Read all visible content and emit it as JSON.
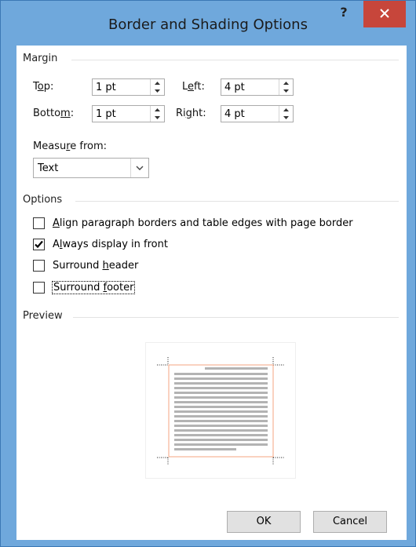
{
  "window": {
    "title": "Border and Shading Options",
    "help_label": "?"
  },
  "margin": {
    "section_label": "Margin",
    "top": {
      "label_pre": "T",
      "label_u": "o",
      "label_post": "p:",
      "value": "1 pt"
    },
    "bottom": {
      "label_pre": "Botto",
      "label_u": "m",
      "label_post": ":",
      "value": "1 pt"
    },
    "left": {
      "label_pre": "L",
      "label_u": "e",
      "label_post": "ft:",
      "value": "4 pt"
    },
    "right": {
      "label_pre": "Ri",
      "label_u": "g",
      "label_post": "ht:",
      "value": "4 pt"
    },
    "measure_from": {
      "label_pre": "Measu",
      "label_u": "r",
      "label_post": "e from:",
      "value": "Text"
    }
  },
  "options": {
    "section_label": "Options",
    "items": [
      {
        "pre": "",
        "u": "A",
        "post": "lign paragraph borders and table edges with page border",
        "checked": false
      },
      {
        "pre": "A",
        "u": "l",
        "post": "ways display in front",
        "checked": true
      },
      {
        "pre": "Surround ",
        "u": "h",
        "post": "eader",
        "checked": false
      },
      {
        "pre": "Surround ",
        "u": "f",
        "post": "ooter",
        "checked": false
      }
    ]
  },
  "preview": {
    "section_label": "Preview"
  },
  "buttons": {
    "ok": "OK",
    "cancel": "Cancel"
  },
  "colors": {
    "title_bg": "#6fa8dc",
    "close_bg": "#c7463b",
    "preview_border": "#f4a582",
    "preview_lines": "#b3b3b3"
  }
}
